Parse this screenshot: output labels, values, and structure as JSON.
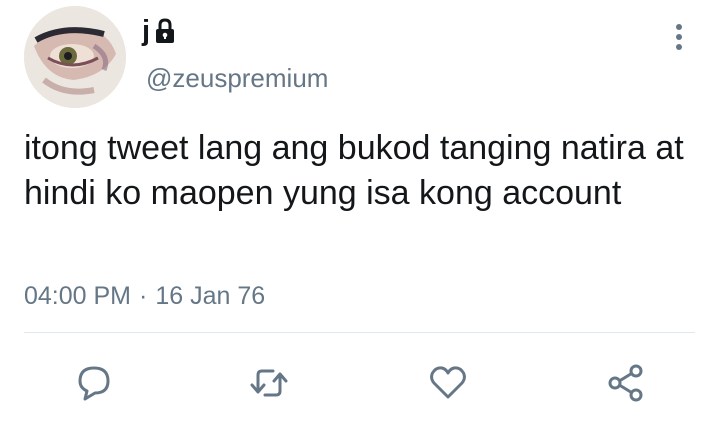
{
  "author": {
    "display_name": "j",
    "handle": "@zeuspremium",
    "protected": true
  },
  "tweet": {
    "text": "itong tweet lang ang bukod tanging natira at hindi ko maopen yung isa kong account",
    "time": "04:00 PM",
    "separator": "·",
    "date": "16 Jan 76"
  },
  "actions": [
    "reply",
    "retweet",
    "like",
    "share"
  ],
  "icons": {
    "more": "more-vertical-icon",
    "lock": "lock-icon",
    "reply": "reply-icon",
    "retweet": "retweet-icon",
    "like": "heart-icon",
    "share": "share-icon"
  },
  "colors": {
    "text": "#14171a",
    "secondary": "#657786",
    "divider": "#e1e8ed"
  }
}
